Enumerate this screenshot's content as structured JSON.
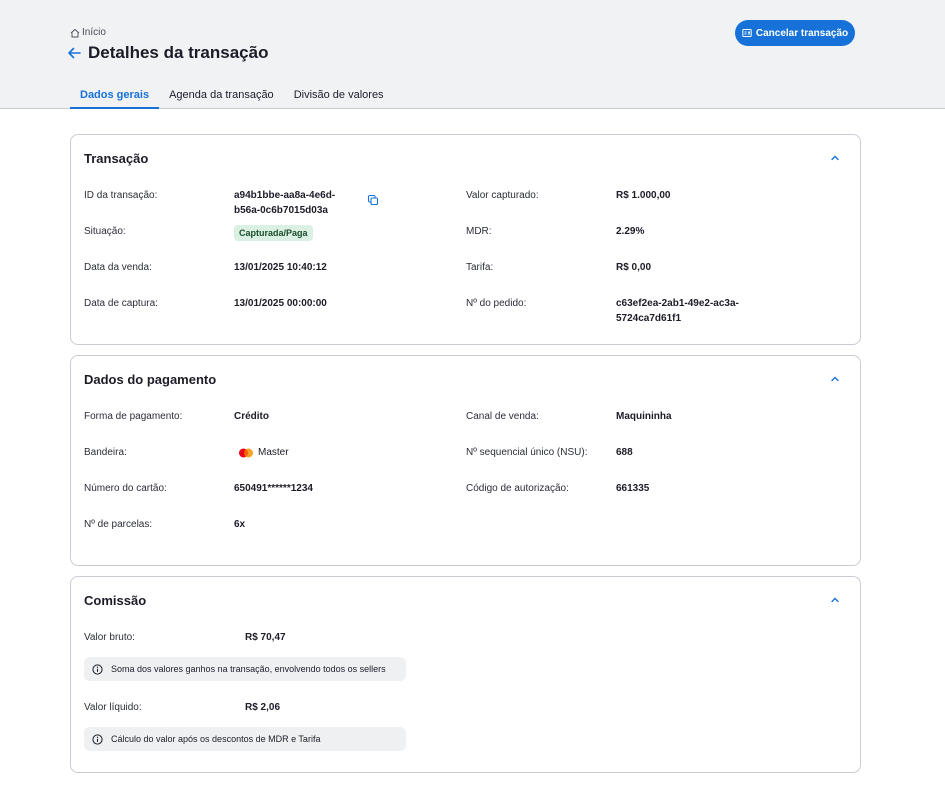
{
  "breadcrumb": {
    "home": "Início"
  },
  "header": {
    "title": "Detalhes da transação",
    "cancel_label": "Cancelar transação"
  },
  "tabs": [
    {
      "label": "Dados gerais",
      "active": true
    },
    {
      "label": "Agenda da transação",
      "active": false
    },
    {
      "label": "Divisão de valores",
      "active": false
    }
  ],
  "transacao": {
    "title": "Transação",
    "id_label": "ID da transação:",
    "id_value_1": "a94b1bbe-aa8a-4e6d-",
    "id_value_2": "b56a-0c6b7015d03a",
    "situacao_label": "Situação:",
    "situacao_value": "Capturada/Paga",
    "data_venda_label": "Data da venda:",
    "data_venda_value": "13/01/2025 10:40:12",
    "data_captura_label": "Data de captura:",
    "data_captura_value": "13/01/2025 00:00:00",
    "valor_capturado_label": "Valor capturado:",
    "valor_capturado_value": "R$ 1.000,00",
    "mdr_label": "MDR:",
    "mdr_value": "2.29%",
    "tarifa_label": "Tarifa:",
    "tarifa_value": "R$ 0,00",
    "pedido_label": "Nº do pedido:",
    "pedido_value_1": "c63ef2ea-2ab1-49e2-ac3a-",
    "pedido_value_2": "5724ca7d61f1"
  },
  "pagamento": {
    "title": "Dados do pagamento",
    "forma_label": "Forma de pagamento:",
    "forma_value": "Crédito",
    "bandeira_label": "Bandeira:",
    "bandeira_value": "Master",
    "cartao_label": "Número do cartão:",
    "cartao_value": "650491******1234",
    "parcelas_label": "Nº de parcelas:",
    "parcelas_value": "6x",
    "canal_label": "Canal de venda:",
    "canal_value": "Maquininha",
    "nsu_label": "Nº sequencial único (NSU):",
    "nsu_value": "688",
    "autorizacao_label": "Código de autorização:",
    "autorizacao_value": "661335"
  },
  "comissao": {
    "title": "Comissão",
    "bruto_label": "Valor bruto:",
    "bruto_value": "R$ 70,47",
    "bruto_info": "Soma dos valores ganhos na transação, envolvendo todos os sellers",
    "liquido_label": "Valor líquido:",
    "liquido_value": "R$ 2,06",
    "liquido_info": "Cálculo do valor após os descontos de MDR e Tarifa"
  },
  "colors": {
    "accent": "#1672d9",
    "badge_bg": "#d9f0e2",
    "header_bg": "#f1f2f4"
  },
  "icons": [
    "home-icon",
    "back-arrow-icon",
    "receipt-icon",
    "copy-icon",
    "chevron-up-icon",
    "mastercard-icon",
    "info-icon"
  ]
}
